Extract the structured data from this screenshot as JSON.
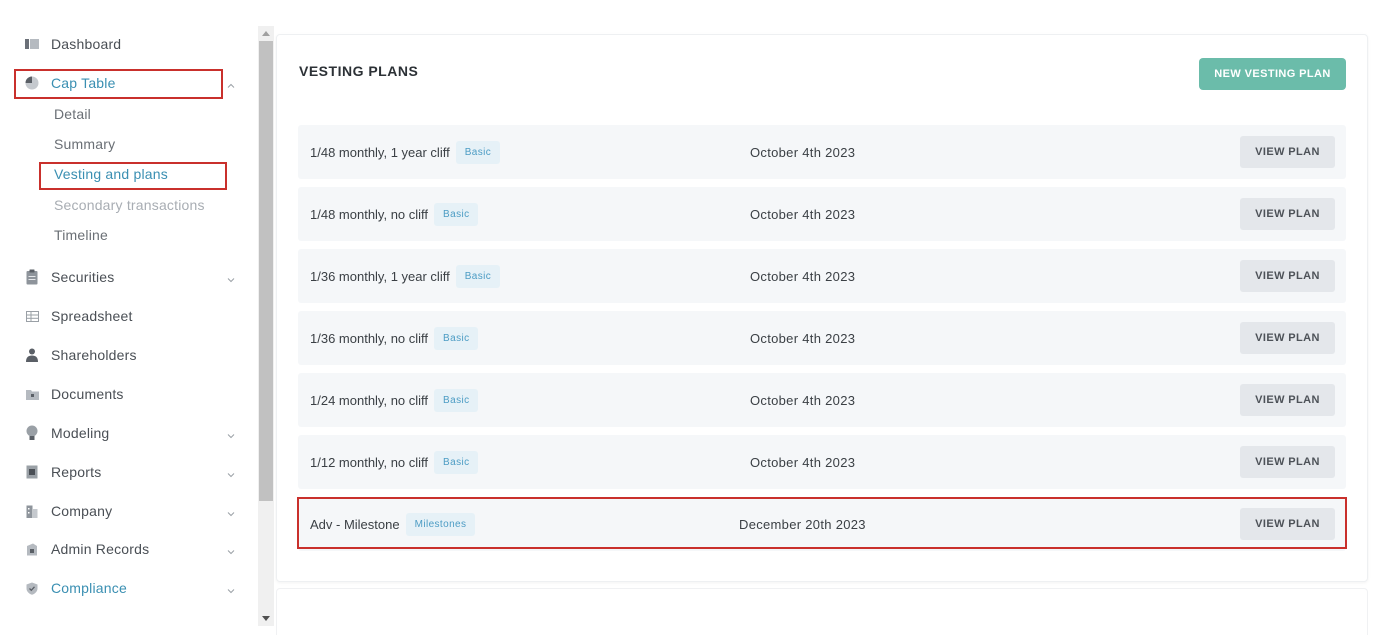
{
  "sidebar": {
    "items": [
      {
        "label": "Dashboard",
        "icon": "dashboard-icon"
      },
      {
        "label": "Cap Table",
        "icon": "pie-chart-icon",
        "expanded": true
      },
      {
        "label": "Securities",
        "icon": "clipboard-icon"
      },
      {
        "label": "Spreadsheet",
        "icon": "spreadsheet-icon"
      },
      {
        "label": "Shareholders",
        "icon": "person-icon"
      },
      {
        "label": "Documents",
        "icon": "folder-icon"
      },
      {
        "label": "Modeling",
        "icon": "lightbulb-icon"
      },
      {
        "label": "Reports",
        "icon": "report-icon"
      },
      {
        "label": "Company",
        "icon": "building-icon"
      },
      {
        "label": "Admin Records",
        "icon": "admin-records-icon"
      },
      {
        "label": "Compliance",
        "icon": "shield-icon"
      }
    ],
    "cap_table_sub": [
      {
        "label": "Detail"
      },
      {
        "label": "Summary"
      },
      {
        "label": "Vesting and plans"
      },
      {
        "label": "Secondary transactions"
      },
      {
        "label": "Timeline"
      }
    ]
  },
  "main": {
    "title": "VESTING PLANS",
    "new_button": "NEW VESTING PLAN",
    "view_button": "VIEW PLAN",
    "plans": [
      {
        "name": "1/48 monthly, 1 year cliff",
        "type": "Basic",
        "date": "October 4th 2023"
      },
      {
        "name": "1/48 monthly, no cliff",
        "type": "Basic",
        "date": "October 4th 2023"
      },
      {
        "name": "1/36 monthly, 1 year cliff",
        "type": "Basic",
        "date": "October 4th 2023"
      },
      {
        "name": "1/36 monthly, no cliff",
        "type": "Basic",
        "date": "October 4th 2023"
      },
      {
        "name": "1/24 monthly, no cliff",
        "type": "Basic",
        "date": "October 4th 2023"
      },
      {
        "name": "1/12 monthly, no cliff",
        "type": "Basic",
        "date": "October 4th 2023"
      },
      {
        "name": "Adv - Milestone",
        "type": "Milestones",
        "date": "December 20th 2023"
      }
    ]
  },
  "colors": {
    "accent": "#3a8fb2",
    "primary_button": "#6bbcaa",
    "highlight": "#c9302c",
    "badge_bg": "#e6f1f7",
    "row_bg": "#f5f7f9"
  }
}
